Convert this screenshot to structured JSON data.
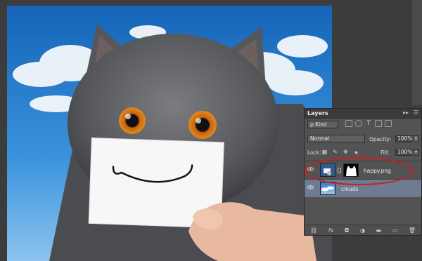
{
  "panel": {
    "tab_label": "Layers",
    "menu_glyph": "▸▸",
    "menu_glyph2": "☰",
    "kind_label": "ρ Kind",
    "blend_mode": "Normal",
    "opacity_label": "Opacity:",
    "opacity_value": "100%",
    "lock_label": "Lock:",
    "fill_label": "Fill:",
    "fill_value": "100%",
    "filter_icons": [
      "image-filter-icon",
      "adjustment-filter-icon",
      "type-filter-icon",
      "shape-filter-icon",
      "smart-object-filter-icon"
    ],
    "lock_icons": [
      "lock-transparency-icon",
      "lock-paint-icon",
      "lock-position-icon",
      "lock-all-icon"
    ],
    "layers": [
      {
        "name": "happy.png",
        "selected": false
      },
      {
        "name": "clouds",
        "selected": true
      }
    ],
    "footer_icons": [
      "link-layers-icon",
      "fx-icon",
      "add-mask-icon",
      "adjustment-layer-icon",
      "new-group-icon",
      "new-layer-icon",
      "delete-layer-icon"
    ],
    "footer_glyphs": [
      "⛓",
      "fx",
      "◘",
      "◑",
      "▬",
      "▭",
      "🗑"
    ]
  },
  "colors": {
    "panel_bg": "#535353",
    "selected_layer": "#6d7b93",
    "annotation_ring": "#d41b1b",
    "sky": "#1a6fc0"
  }
}
